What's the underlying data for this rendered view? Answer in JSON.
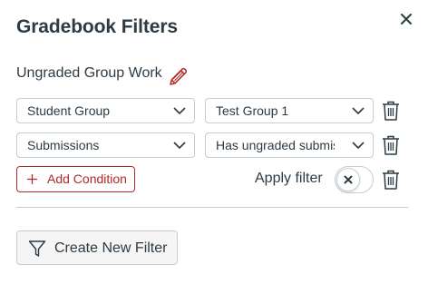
{
  "panel": {
    "title": "Gradebook Filters"
  },
  "filter": {
    "name": "Ungraded Group Work",
    "conditions": [
      {
        "field": "Student Group",
        "value": "Test Group 1"
      },
      {
        "field": "Submissions",
        "value": "Has ungraded submiss"
      }
    ],
    "add_condition_label": "Add Condition",
    "apply_filter_label": "Apply filter",
    "apply_filter_on": false
  },
  "footer": {
    "create_new_filter_label": "Create New Filter"
  },
  "colors": {
    "text": "#2d3b45",
    "danger": "#b22828",
    "border": "#c7cdd1"
  },
  "icons": {
    "close": "close-icon",
    "edit": "pencil-icon",
    "dropdown": "chevron-down-icon",
    "delete": "trash-icon",
    "add": "plus-icon",
    "toggle": "x-icon",
    "filter": "funnel-icon"
  }
}
